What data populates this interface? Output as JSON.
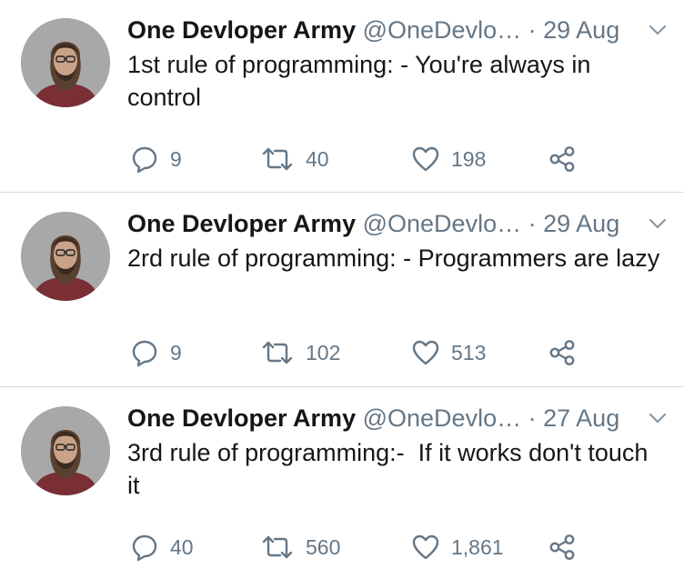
{
  "tweets": [
    {
      "name": "One Devloper Army",
      "handle": "@OneDevlo…",
      "separator": "·",
      "date": "29 Aug",
      "text": "1st rule of programming: - You're always in control",
      "replies": "9",
      "retweets": "40",
      "likes": "198"
    },
    {
      "name": "One Devloper Army",
      "handle": "@OneDevlo…",
      "separator": "·",
      "date": "29 Aug",
      "text": "2rd rule of programming: - Programmers are lazy",
      "replies": "9",
      "retweets": "102",
      "likes": "513"
    },
    {
      "name": "One Devloper Army",
      "handle": "@OneDevlo…",
      "separator": "·",
      "date": "27 Aug",
      "text": "3rd rule of programming:-  If it works don't touch it",
      "replies": "40",
      "retweets": "560",
      "likes": "1,861"
    }
  ],
  "icons": {
    "reply": "reply-icon",
    "retweet": "retweet-icon",
    "like": "heart-icon",
    "share": "share-icon",
    "caret": "chevron-down-icon"
  },
  "colors": {
    "text": "#14171a",
    "muted": "#657786",
    "divider": "#d6dbdf"
  }
}
